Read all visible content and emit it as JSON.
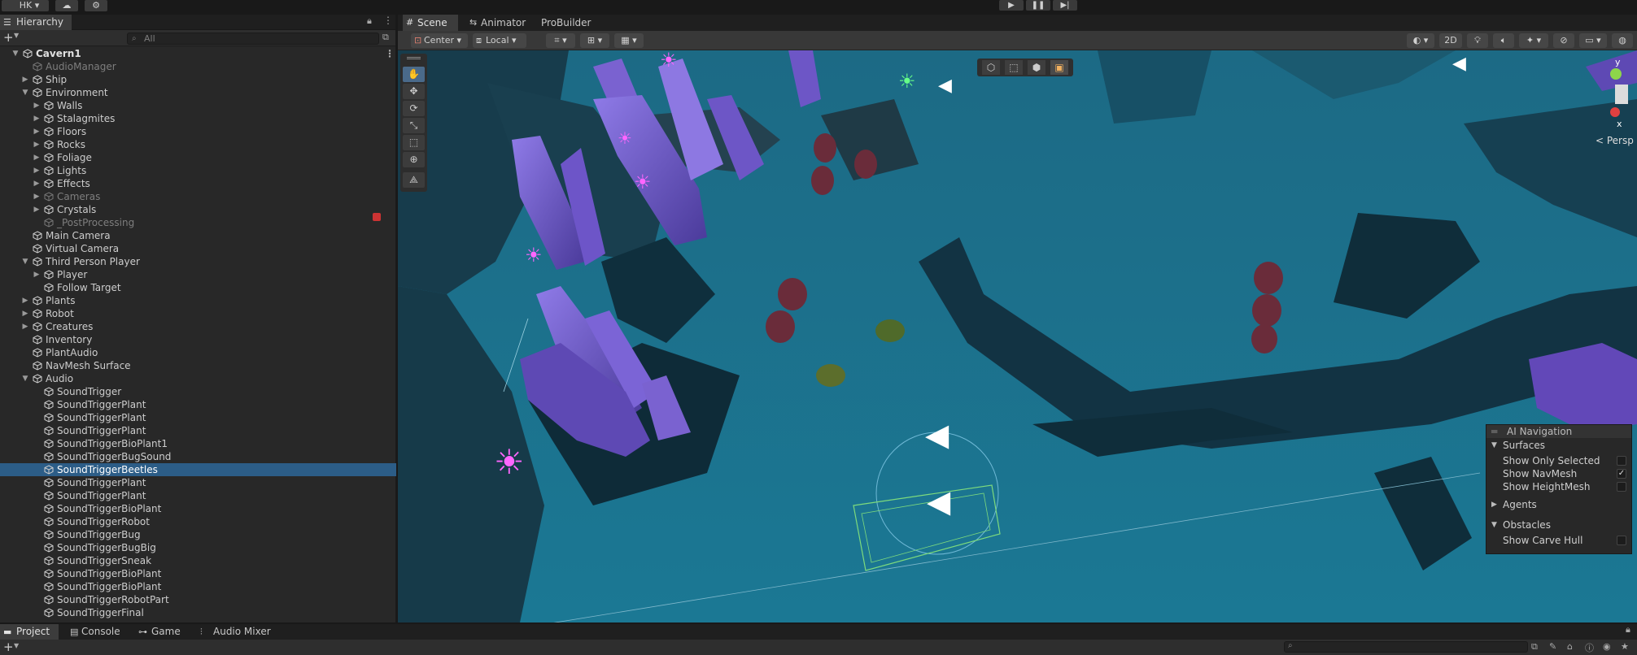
{
  "topbar": {
    "account_label": "HK"
  },
  "hierarchy": {
    "tab_label": "Hierarchy",
    "search_placeholder": "All",
    "items": [
      {
        "label": "Cavern1",
        "depth": 0,
        "arrow": "open",
        "root": true
      },
      {
        "label": "AudioManager",
        "depth": 1,
        "dim": true
      },
      {
        "label": "Ship",
        "depth": 1,
        "arrow": "closed"
      },
      {
        "label": "Environment",
        "depth": 1,
        "arrow": "open"
      },
      {
        "label": "Walls",
        "depth": 2,
        "arrow": "closed"
      },
      {
        "label": "Stalagmites",
        "depth": 2,
        "arrow": "closed"
      },
      {
        "label": "Floors",
        "depth": 2,
        "arrow": "closed"
      },
      {
        "label": "Rocks",
        "depth": 2,
        "arrow": "closed"
      },
      {
        "label": "Foliage",
        "depth": 2,
        "arrow": "closed"
      },
      {
        "label": "Lights",
        "depth": 2,
        "arrow": "closed"
      },
      {
        "label": "Effects",
        "depth": 2,
        "arrow": "closed"
      },
      {
        "label": "Cameras",
        "depth": 2,
        "arrow": "closed",
        "dim": true
      },
      {
        "label": "Crystals",
        "depth": 2,
        "arrow": "closed"
      },
      {
        "label": "_PostProcessing",
        "depth": 2,
        "dim": true
      },
      {
        "label": "Main Camera",
        "depth": 1
      },
      {
        "label": "Virtual Camera",
        "depth": 1
      },
      {
        "label": "Third Person Player",
        "depth": 1,
        "arrow": "open"
      },
      {
        "label": "Player",
        "depth": 2,
        "arrow": "closed"
      },
      {
        "label": "Follow Target",
        "depth": 2
      },
      {
        "label": "Plants",
        "depth": 1,
        "arrow": "closed"
      },
      {
        "label": "Robot",
        "depth": 1,
        "arrow": "closed"
      },
      {
        "label": "Creatures",
        "depth": 1,
        "arrow": "closed"
      },
      {
        "label": "Inventory",
        "depth": 1
      },
      {
        "label": "PlantAudio",
        "depth": 1
      },
      {
        "label": "NavMesh Surface",
        "depth": 1
      },
      {
        "label": "Audio",
        "depth": 1,
        "arrow": "open"
      },
      {
        "label": "SoundTrigger",
        "depth": 2
      },
      {
        "label": "SoundTriggerPlant",
        "depth": 2
      },
      {
        "label": "SoundTriggerPlant",
        "depth": 2
      },
      {
        "label": "SoundTriggerPlant",
        "depth": 2
      },
      {
        "label": "SoundTriggerBioPlant1",
        "depth": 2
      },
      {
        "label": "SoundTriggerBugSound",
        "depth": 2
      },
      {
        "label": "SoundTriggerBeetles",
        "depth": 2,
        "selected": true
      },
      {
        "label": "SoundTriggerPlant",
        "depth": 2
      },
      {
        "label": "SoundTriggerPlant",
        "depth": 2
      },
      {
        "label": "SoundTriggerBioPlant",
        "depth": 2
      },
      {
        "label": "SoundTriggerRobot",
        "depth": 2
      },
      {
        "label": "SoundTriggerBug",
        "depth": 2
      },
      {
        "label": "SoundTriggerBugBig",
        "depth": 2
      },
      {
        "label": "SoundTriggerSneak",
        "depth": 2
      },
      {
        "label": "SoundTriggerBioPlant",
        "depth": 2
      },
      {
        "label": "SoundTriggerBioPlant",
        "depth": 2
      },
      {
        "label": "SoundTriggerRobotPart",
        "depth": 2
      },
      {
        "label": "SoundTriggerFinal",
        "depth": 2
      }
    ]
  },
  "scene": {
    "tabs": [
      "Scene",
      "Animator",
      "ProBuilder"
    ],
    "pivot_label": "Center",
    "space_label": "Local",
    "mode_2d_label": "2D",
    "persp_label": "< Persp",
    "gizmo_y": "y",
    "gizmo_x": "x"
  },
  "ai_navigation": {
    "title": "AI Navigation",
    "surfaces_label": "Surfaces",
    "show_only_selected": "Show Only Selected",
    "show_navmesh": "Show NavMesh",
    "show_heightmesh": "Show HeightMesh",
    "agents_label": "Agents",
    "obstacles_label": "Obstacles",
    "show_carve_hull": "Show Carve Hull",
    "navmesh_checked": "✓"
  },
  "bottom": {
    "tabs": [
      "Project",
      "Console",
      "Game",
      "Audio Mixer"
    ]
  },
  "colors": {
    "selection": "#2c5d87",
    "water": "#1a6680",
    "crystal": "#7a5bd0",
    "light_gizmo": "#ff66ff"
  }
}
